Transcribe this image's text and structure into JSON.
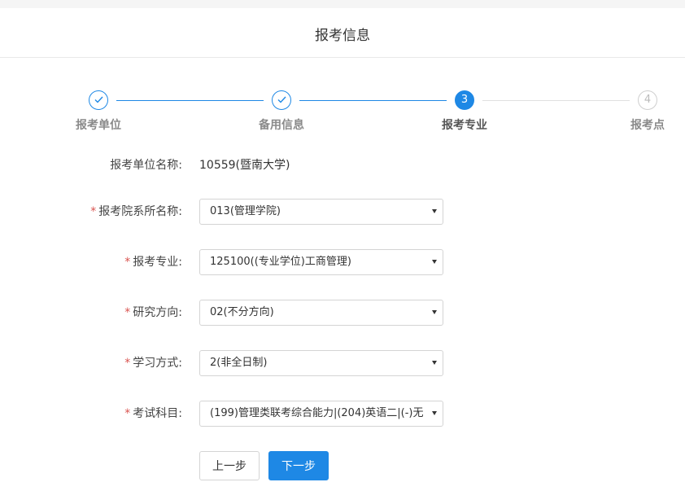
{
  "header": {
    "title": "报考信息"
  },
  "steps": [
    {
      "label": "报考单位",
      "number": "1",
      "status": "done"
    },
    {
      "label": "备用信息",
      "number": "2",
      "status": "done"
    },
    {
      "label": "报考专业",
      "number": "3",
      "status": "current"
    },
    {
      "label": "报考点",
      "number": "4",
      "status": "pending"
    }
  ],
  "form": {
    "unit": {
      "label": "报考单位名称:",
      "value": "10559(暨南大学)"
    },
    "department": {
      "required": "*",
      "label": "报考院系所名称:",
      "value": "013(管理学院)"
    },
    "major": {
      "required": "*",
      "label": "报考专业:",
      "value": "125100((专业学位)工商管理)"
    },
    "direction": {
      "required": "*",
      "label": "研究方向:",
      "value": "02(不分方向)"
    },
    "study_mode": {
      "required": "*",
      "label": "学习方式:",
      "value": "2(非全日制)"
    },
    "subjects": {
      "required": "*",
      "label": "考试科目:",
      "value": "(199)管理类联考综合能力|(204)英语二|(-)无"
    }
  },
  "buttons": {
    "prev": "上一步",
    "next": "下一步"
  },
  "colors": {
    "accent": "#1e88e5",
    "required": "#d9534f",
    "pending": "#cfcfcf"
  }
}
